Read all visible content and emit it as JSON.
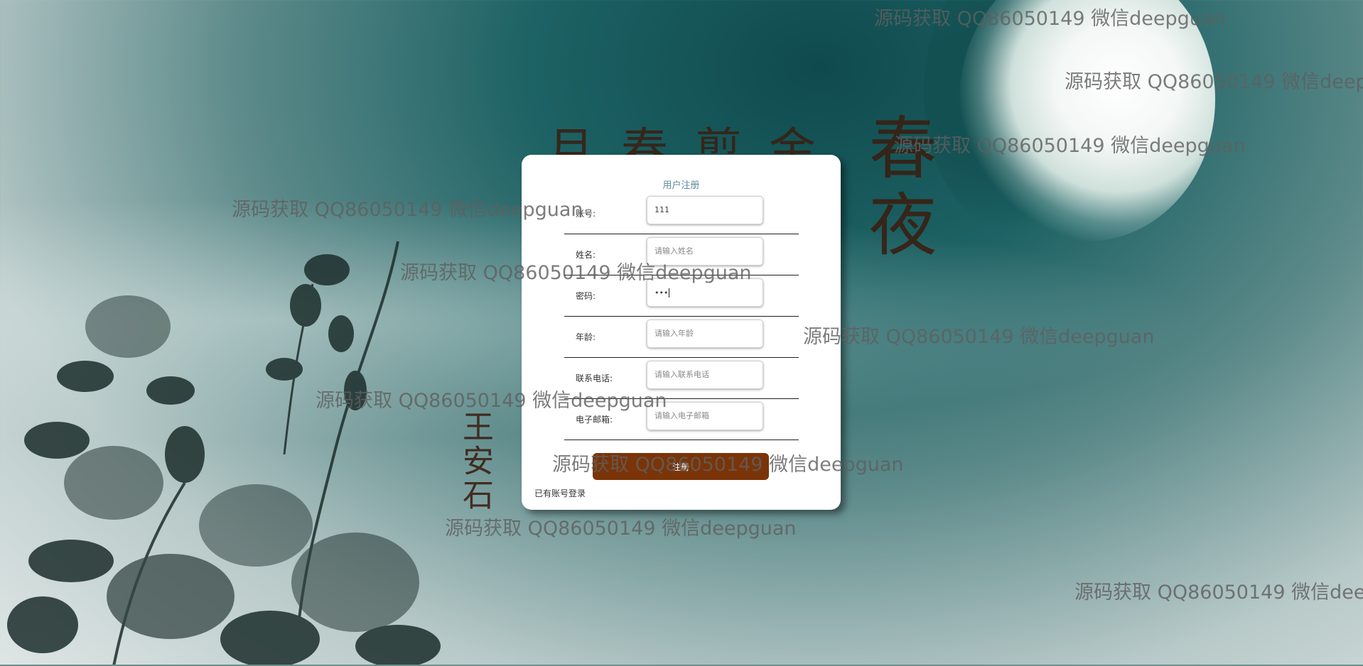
{
  "background": {
    "poem_title": "月春剪金",
    "poem_large": "春夜",
    "author": "王安石"
  },
  "form": {
    "title": "用户注册",
    "fields": [
      {
        "label": "账号:",
        "value": "111",
        "placeholder": ""
      },
      {
        "label": "姓名:",
        "value": "",
        "placeholder": "请输入姓名"
      },
      {
        "label": "密码:",
        "value": "•••",
        "placeholder": ""
      },
      {
        "label": "年龄:",
        "value": "",
        "placeholder": "请输入年龄"
      },
      {
        "label": "联系电话:",
        "value": "",
        "placeholder": "请输入联系电话"
      },
      {
        "label": "电子邮箱:",
        "value": "",
        "placeholder": "请输入电子邮箱"
      }
    ],
    "submit_label": "注册",
    "login_link": "已有账号登录"
  },
  "watermark": {
    "text": "源码获取 QQ86050149 微信deepguan"
  },
  "colors": {
    "submit": "#7a3408",
    "title": "#5b8a9a",
    "ink": "#3a1e10"
  }
}
